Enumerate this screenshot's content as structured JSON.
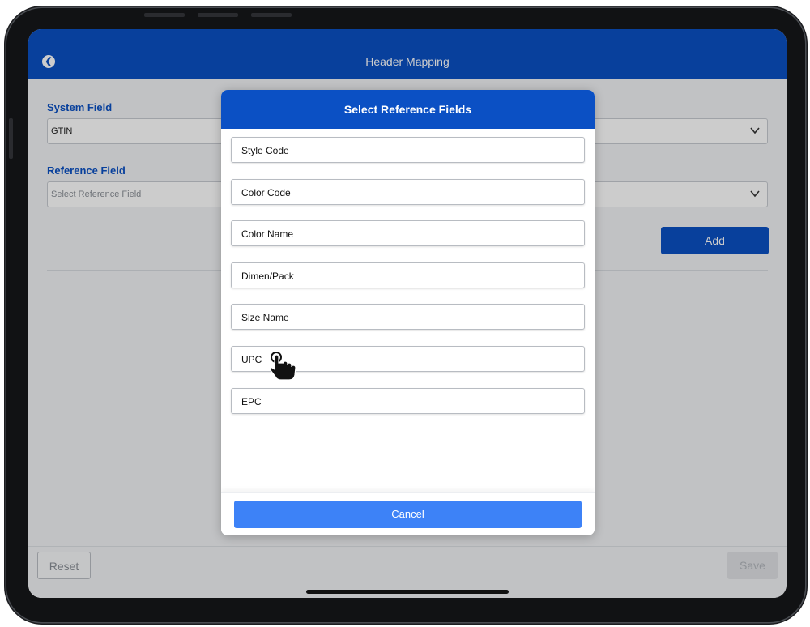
{
  "header": {
    "title": "Header Mapping"
  },
  "form": {
    "system_field": {
      "label": "System Field",
      "value": "GTIN"
    },
    "reference_field": {
      "label": "Reference Field",
      "placeholder": "Select Reference Field"
    },
    "add_label": "Add"
  },
  "footer": {
    "reset_label": "Reset",
    "save_label": "Save"
  },
  "modal": {
    "title": "Select Reference Fields",
    "options": [
      "Style Code",
      "Color Code",
      "Color Name",
      "Dimen/Pack",
      "Size Name",
      "UPC",
      "EPC"
    ],
    "cancel_label": "Cancel"
  },
  "icons": {
    "back": "back-arrow-circle-icon",
    "dropdown": "chevron-down-icon",
    "cursor": "hand-pointer-icon"
  },
  "colors": {
    "primary": "#0b50c4",
    "cancel_button": "#3d82f7",
    "label_blue": "#0b50c4"
  }
}
